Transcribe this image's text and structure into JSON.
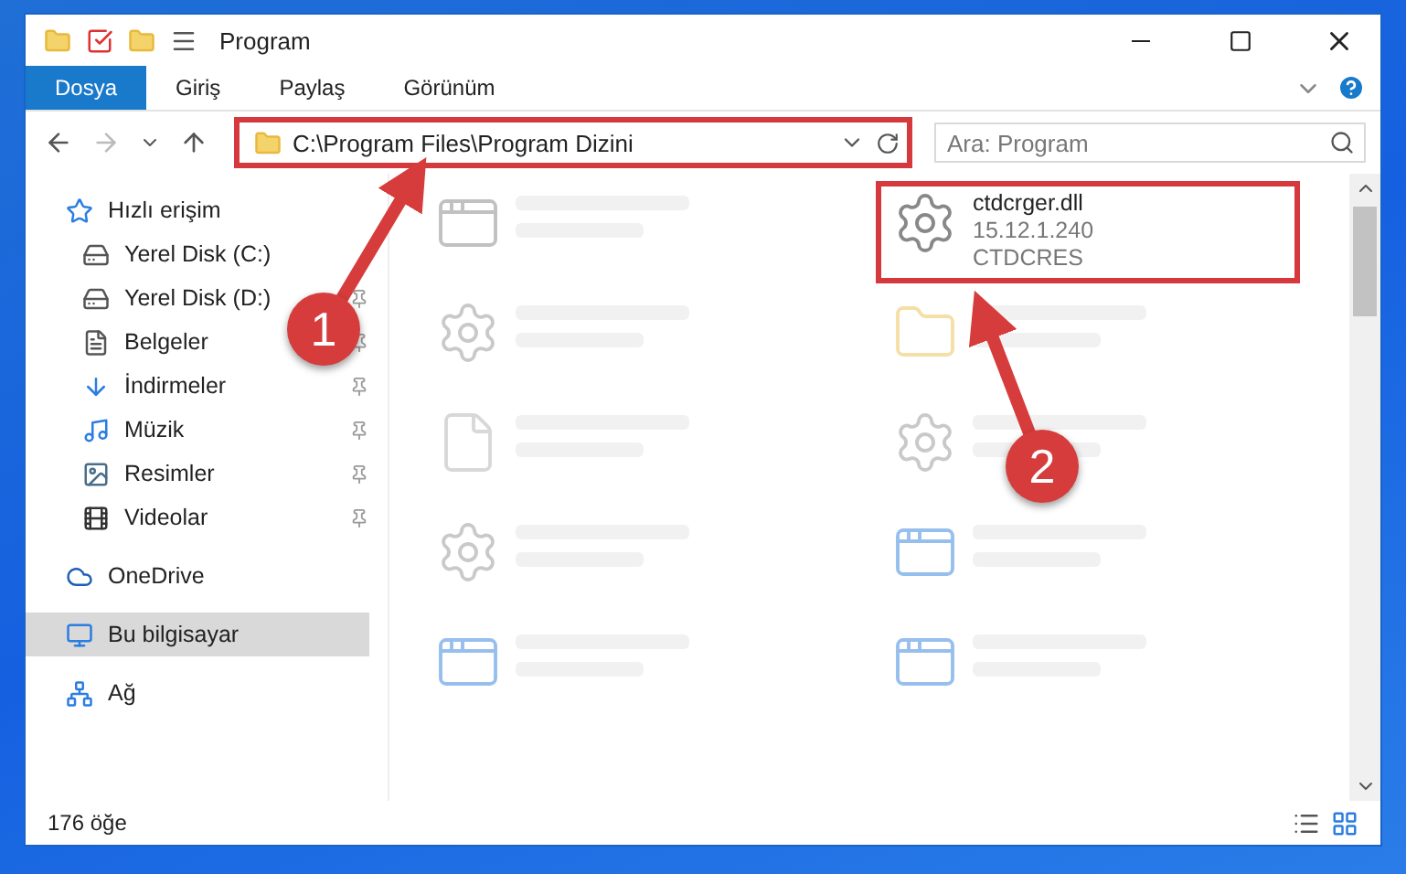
{
  "window": {
    "title": "Program"
  },
  "ribbon": {
    "tabs": [
      {
        "label": "Dosya",
        "selected": true
      },
      {
        "label": "Giriş",
        "selected": false
      },
      {
        "label": "Paylaş",
        "selected": false
      },
      {
        "label": "Görünüm",
        "selected": false
      }
    ]
  },
  "address": {
    "value": "C:\\Program Files\\Program Dizini",
    "highlighted": true
  },
  "search": {
    "placeholder": "Ara: Program"
  },
  "sidebar": {
    "items": [
      {
        "label": "Hızlı erişim",
        "kind": "star",
        "selected": false,
        "children": [
          {
            "label": "Yerel Disk (C:)",
            "kind": "disk",
            "pinned": false,
            "selected": false
          },
          {
            "label": "Yerel Disk (D:)",
            "kind": "disk",
            "pinned": true,
            "selected": false
          },
          {
            "label": "Belgeler",
            "kind": "docs",
            "pinned": true,
            "selected": false
          },
          {
            "label": "İndirmeler",
            "kind": "download",
            "pinned": true,
            "selected": false
          },
          {
            "label": "Müzik",
            "kind": "music",
            "pinned": true,
            "selected": false
          },
          {
            "label": "Resimler",
            "kind": "pictures",
            "pinned": true,
            "selected": false
          },
          {
            "label": "Videolar",
            "kind": "videos",
            "pinned": true,
            "selected": false
          }
        ]
      },
      {
        "label": "OneDrive",
        "kind": "cloud",
        "selected": false
      },
      {
        "label": "Bu bilgisayar",
        "kind": "computer",
        "selected": true
      },
      {
        "label": "Ağ",
        "kind": "network",
        "selected": false
      }
    ]
  },
  "files": {
    "items": [
      {
        "kind": "exe",
        "blurred": true,
        "highlighted": false
      },
      {
        "name": "ctdcrger.dll",
        "lines": [
          "15.12.1.240",
          "CTDCRES"
        ],
        "kind": "dll",
        "blurred": false,
        "highlighted": true
      },
      {
        "kind": "dll",
        "blurred": true,
        "highlighted": false
      },
      {
        "kind": "folder",
        "blurred": true,
        "highlighted": false
      },
      {
        "kind": "file",
        "blurred": true,
        "highlighted": false
      },
      {
        "kind": "dll",
        "blurred": true,
        "highlighted": false
      },
      {
        "kind": "dll",
        "blurred": true,
        "highlighted": false
      },
      {
        "kind": "app",
        "blurred": true,
        "highlighted": false
      },
      {
        "kind": "app",
        "blurred": true,
        "highlighted": false
      },
      {
        "kind": "app",
        "blurred": true,
        "highlighted": false
      }
    ]
  },
  "status_bar": {
    "count": "176 öğe"
  },
  "annotations": [
    {
      "label": "1"
    },
    {
      "label": "2"
    }
  ]
}
